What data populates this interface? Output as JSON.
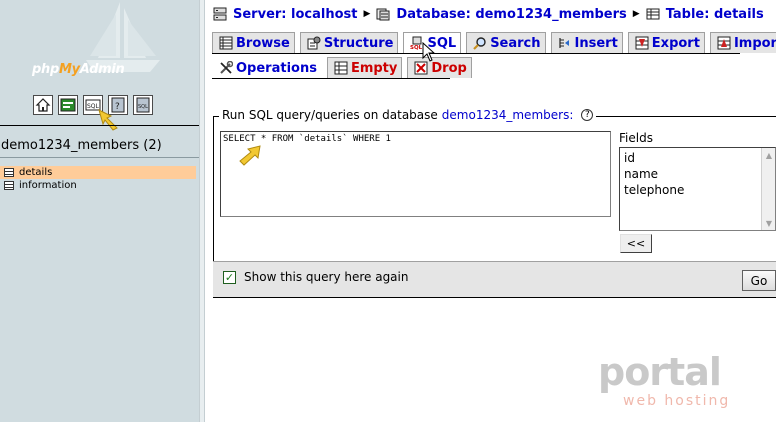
{
  "sidebar": {
    "logo": {
      "php": "php",
      "my": "My",
      "admin": "Admin"
    },
    "nav_icons": [
      "home-icon",
      "query-window-icon",
      "sql-query-icon",
      "docs-icon",
      "sql-docs-icon"
    ],
    "database_label": "demo1234_members (2)",
    "tables": [
      {
        "label": "details",
        "active": true
      },
      {
        "label": "information",
        "active": false
      }
    ]
  },
  "breadcrumb": {
    "server": "Server: localhost",
    "database": "Database: demo1234_members",
    "table": "Table: details"
  },
  "tabs_row1": [
    {
      "label": "Browse",
      "icon": "browse-icon"
    },
    {
      "label": "Structure",
      "icon": "structure-icon"
    },
    {
      "label": "SQL",
      "icon": "sql-icon",
      "active": true
    },
    {
      "label": "Search",
      "icon": "search-icon"
    },
    {
      "label": "Insert",
      "icon": "insert-icon"
    },
    {
      "label": "Export",
      "icon": "export-icon"
    },
    {
      "label": "Import",
      "icon": "import-icon"
    }
  ],
  "tabs_row2": [
    {
      "label": "Operations",
      "icon": "operations-icon"
    },
    {
      "label": "Empty",
      "icon": "empty-icon"
    },
    {
      "label": "Drop",
      "icon": "drop-icon"
    }
  ],
  "query": {
    "legend_prefix": "Run SQL query/queries on database",
    "legend_db": "demo1234_members:",
    "sql_text": "SELECT * FROM `details` WHERE 1",
    "fields_label": "Fields",
    "fields": [
      "id",
      "name",
      "telephone"
    ],
    "insert_button": "<<",
    "show_again_label": "Show this query here again",
    "show_again_checked": true,
    "go_button": "Go"
  },
  "watermark": {
    "word": "portal",
    "sub": "web hosting"
  },
  "colors": {
    "sidebar_bg": "#d0dce0",
    "link": "#0000cc",
    "danger": "#cc0000",
    "active_table": "#ffcc99"
  }
}
